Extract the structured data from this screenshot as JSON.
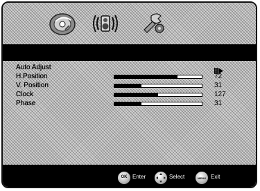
{
  "menu": {
    "tabs": [
      {
        "label": "picture",
        "icon": "picture-disc-icon"
      },
      {
        "label": "sound",
        "icon": "speaker-icon"
      },
      {
        "label": "setup",
        "icon": "tools-icon"
      }
    ],
    "items": [
      {
        "label": "Auto Adjust",
        "value": null,
        "icon": "enter-arrow-icon"
      },
      {
        "label": "H.Position",
        "value": "72",
        "level": 0.72
      },
      {
        "label": "V. Position",
        "value": "31",
        "level": 0.31
      },
      {
        "label": "Clock",
        "value": "127",
        "level": 0.5
      },
      {
        "label": "Phase",
        "value": "31",
        "level": 0.31
      }
    ]
  },
  "footer": {
    "ok_button": "OK",
    "ok_label": "Enter",
    "select_label": "Select",
    "menu_button": "MENU",
    "menu_label": "Exit"
  }
}
